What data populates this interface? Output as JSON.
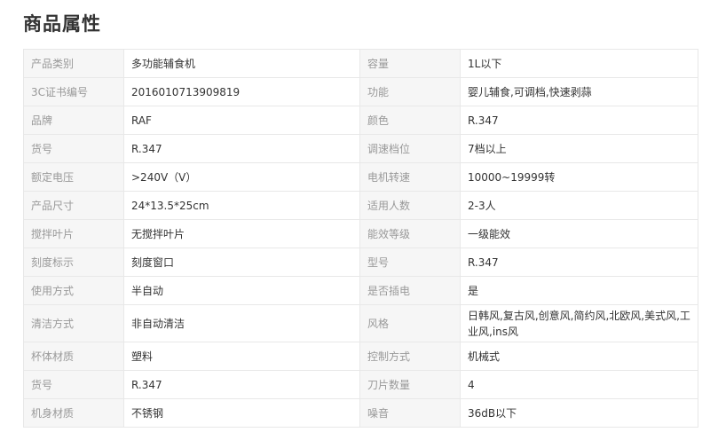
{
  "title": "商品属性",
  "rows": [
    {
      "k1": "产品类别",
      "v1": "多功能辅食机",
      "k2": "容量",
      "v2": "1L以下"
    },
    {
      "k1": "3C证书编号",
      "v1": "2016010713909819",
      "k2": "功能",
      "v2": "婴儿辅食,可调档,快速剥蒜"
    },
    {
      "k1": "品牌",
      "v1": "RAF",
      "k2": "颜色",
      "v2": "R.347"
    },
    {
      "k1": "货号",
      "v1": "R.347",
      "k2": "调速档位",
      "v2": "7档以上"
    },
    {
      "k1": "额定电压",
      "v1": ">240V（V）",
      "k2": "电机转速",
      "v2": "10000~19999转"
    },
    {
      "k1": "产品尺寸",
      "v1": "24*13.5*25cm",
      "k2": "适用人数",
      "v2": "2-3人"
    },
    {
      "k1": "搅拌叶片",
      "v1": "无搅拌叶片",
      "k2": "能效等级",
      "v2": "一级能效"
    },
    {
      "k1": "刻度标示",
      "v1": "刻度窗口",
      "k2": "型号",
      "v2": "R.347"
    },
    {
      "k1": "使用方式",
      "v1": "半自动",
      "k2": "是否插电",
      "v2": "是"
    },
    {
      "k1": "清洁方式",
      "v1": "非自动清洁",
      "k2": "风格",
      "v2": "日韩风,复古风,创意风,简约风,北欧风,美式风,工业风,ins风"
    },
    {
      "k1": "杯体材质",
      "v1": "塑料",
      "k2": "控制方式",
      "v2": "机械式"
    },
    {
      "k1": "货号",
      "v1": "R.347",
      "k2": "刀片数量",
      "v2": "4"
    },
    {
      "k1": "机身材质",
      "v1": "不锈钢",
      "k2": "噪音",
      "v2": "36dB以下"
    }
  ]
}
